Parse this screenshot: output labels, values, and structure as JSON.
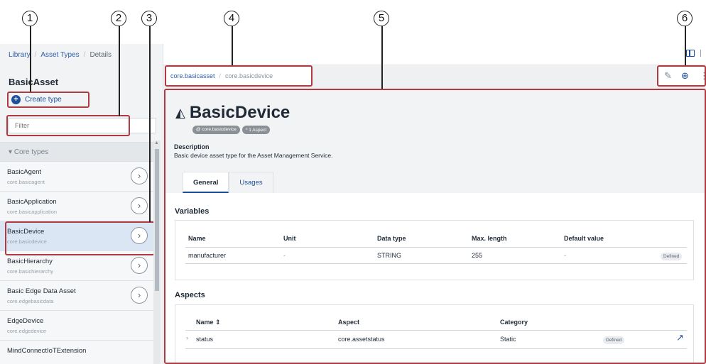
{
  "callouts": [
    "1",
    "2",
    "3",
    "4",
    "5",
    "6"
  ],
  "breadcrumb": {
    "items": [
      "Library",
      "Asset Types",
      "Details"
    ]
  },
  "left": {
    "title": "BasicAsset",
    "create_label": "Create type",
    "filter_placeholder": "Filter",
    "group": "Core types",
    "items": [
      {
        "name": "BasicAgent",
        "sub": "core.basicagent"
      },
      {
        "name": "BasicApplication",
        "sub": "core.basicapplication"
      },
      {
        "name": "BasicDevice",
        "sub": "core.basicdevice"
      },
      {
        "name": "BasicHierarchy",
        "sub": "core.basichierarchy"
      },
      {
        "name": "Basic Edge Data Asset",
        "sub": "core.edgebasicdata"
      },
      {
        "name": "EdgeDevice",
        "sub": "core.edgedevice"
      },
      {
        "name": "MindConnectIoTExtension",
        "sub": ""
      }
    ]
  },
  "path": {
    "parent": "core.basicasset",
    "current": "core.basicdevice"
  },
  "detail": {
    "title": "BasicDevice",
    "badge_id": "@ core.basicdevice",
    "badge_aspect": "⁰ 1 Aspect",
    "desc_label": "Description",
    "desc_text": "Basic device asset type for the Asset Management Service.",
    "tabs": [
      "General",
      "Usages"
    ],
    "variables_title": "Variables",
    "variables_headers": [
      "Name",
      "Unit",
      "Data type",
      "Max. length",
      "Default value"
    ],
    "variables_rows": [
      {
        "name": "manufacturer",
        "unit": "-",
        "type": "STRING",
        "max": "255",
        "default": "-",
        "status": "Defined"
      }
    ],
    "aspects_title": "Aspects",
    "aspects_headers": [
      "Name ⇕",
      "Aspect",
      "Category"
    ],
    "aspects_rows": [
      {
        "name": "status",
        "aspect": "core.assetstatus",
        "category": "Static",
        "status": "Defined"
      }
    ]
  },
  "icons": {
    "create": "plus-circle-icon",
    "chevron": "chevron-right-circle-icon",
    "edit": "pencil-icon",
    "add": "plus-circle-icon",
    "more": "more-icon",
    "open": "external-arrow-icon",
    "panel": "panel-toggle-icon"
  },
  "colors": {
    "highlight": "#b03a42",
    "accent": "#1b4f9c",
    "selected": "#dbe6f5"
  }
}
